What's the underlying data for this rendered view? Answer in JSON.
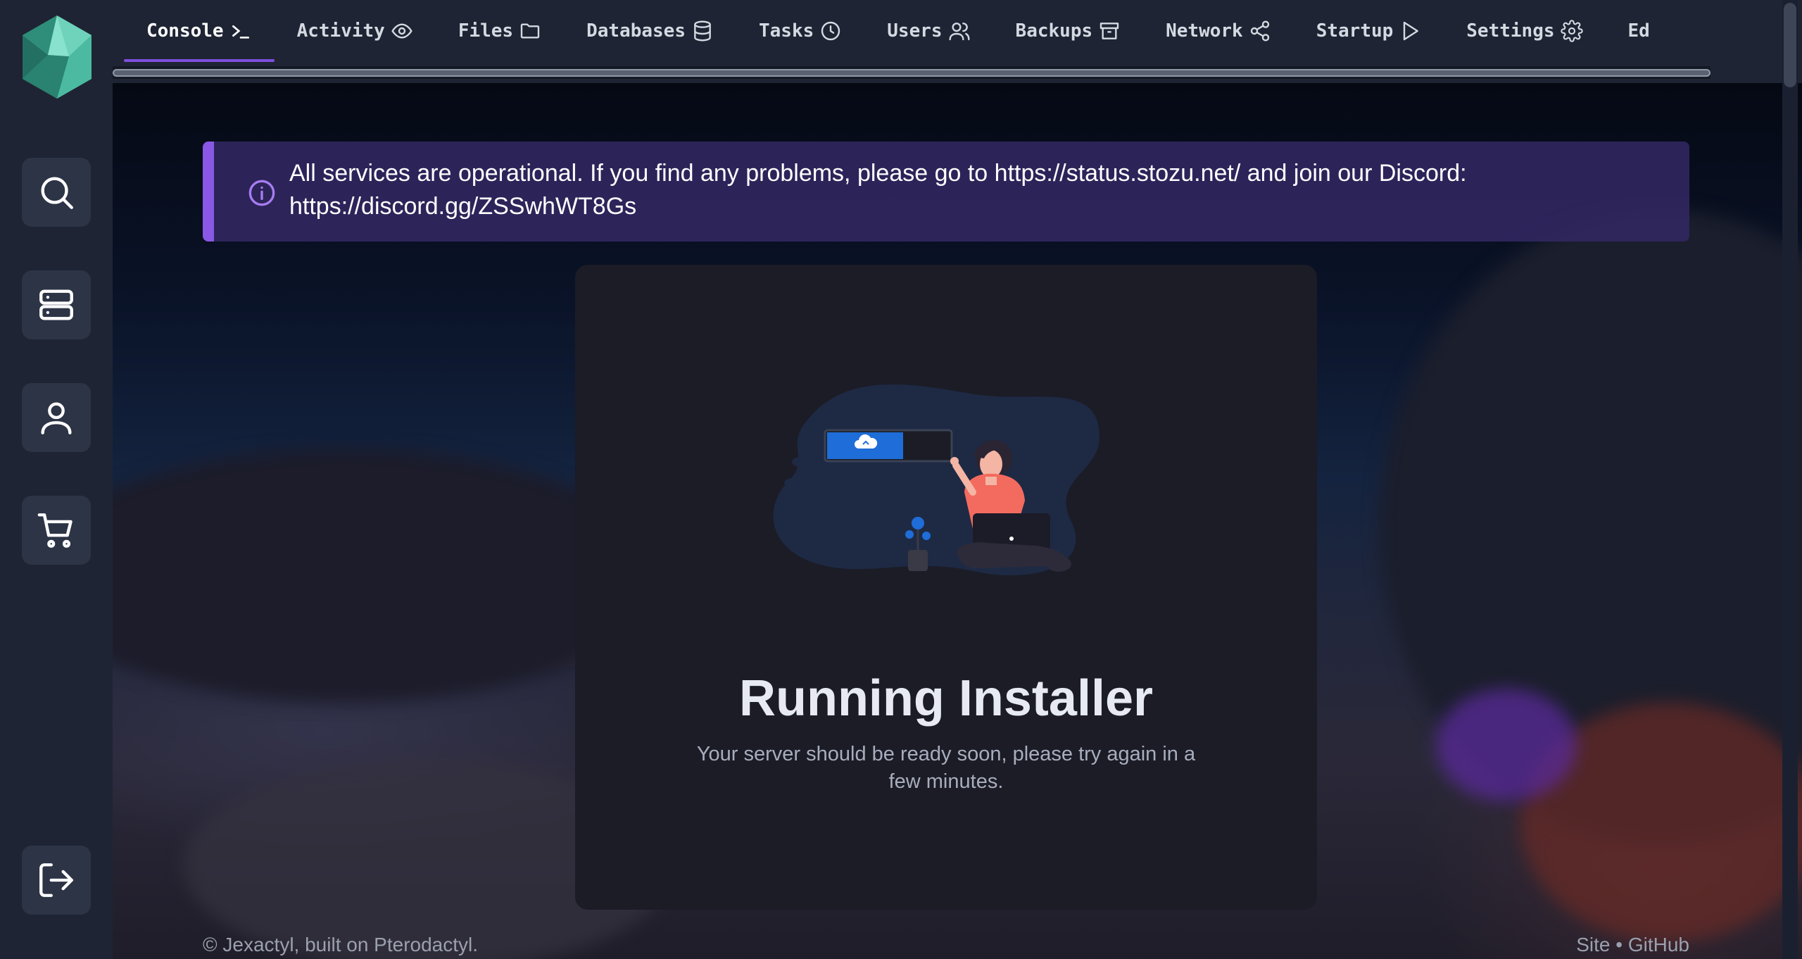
{
  "nav": {
    "tabs": [
      {
        "label": "Console",
        "icon": "terminal-icon",
        "active": true
      },
      {
        "label": "Activity",
        "icon": "eye-icon"
      },
      {
        "label": "Files",
        "icon": "folder-icon"
      },
      {
        "label": "Databases",
        "icon": "database-icon"
      },
      {
        "label": "Tasks",
        "icon": "clock-icon"
      },
      {
        "label": "Users",
        "icon": "users-icon"
      },
      {
        "label": "Backups",
        "icon": "archive-icon"
      },
      {
        "label": "Network",
        "icon": "share-icon"
      },
      {
        "label": "Startup",
        "icon": "play-icon"
      },
      {
        "label": "Settings",
        "icon": "gear-icon"
      },
      {
        "label": "Ed",
        "icon": ""
      }
    ]
  },
  "sidebar": {
    "items": [
      {
        "name": "search",
        "icon": "search-icon"
      },
      {
        "name": "servers",
        "icon": "server-icon"
      },
      {
        "name": "account",
        "icon": "user-icon"
      },
      {
        "name": "store",
        "icon": "cart-icon"
      }
    ],
    "logout_icon": "logout-icon"
  },
  "alert": {
    "icon": "info-icon",
    "text": "All services are operational. If you find any problems, please go to https://status.stozu.net/ and join our Discord: https://discord.gg/ZSSwhWT8Gs"
  },
  "installer": {
    "title": "Running Installer",
    "message": "Your server should be ready soon, please try again in a few minutes."
  },
  "footer": {
    "copyright": "© Jexactyl, built on Pterodactyl.",
    "site_link": "Site",
    "separator": "•",
    "github_link": "GitHub"
  },
  "colors": {
    "accent": "#7e4fe0",
    "alert_bg": "#322862",
    "panel": "#1e2433",
    "card": "#1b1c26"
  }
}
